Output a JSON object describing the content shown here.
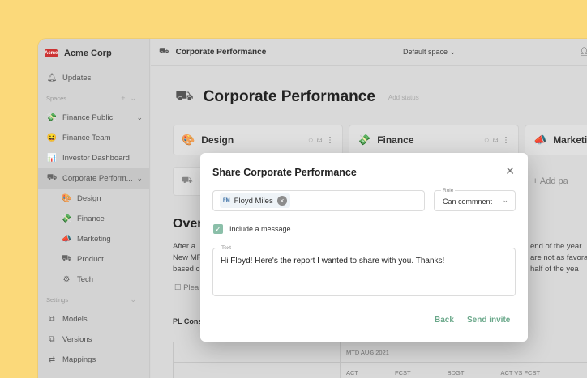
{
  "sidebar": {
    "org_logo": "Acme",
    "org_name": "Acme Corp",
    "updates": "Updates",
    "spaces_label": "Spaces",
    "items": [
      {
        "label": "Finance Public",
        "icon": "💸"
      },
      {
        "label": "Finance Team",
        "icon": "😀"
      },
      {
        "label": "Investor Dashboard",
        "icon": "📊"
      },
      {
        "label": "Corporate Perform...",
        "icon": "⛟"
      }
    ],
    "children": [
      {
        "label": "Design",
        "icon": "🎨"
      },
      {
        "label": "Finance",
        "icon": "💸"
      },
      {
        "label": "Marketing",
        "icon": "📣"
      },
      {
        "label": "Product",
        "icon": "⛟"
      },
      {
        "label": "Tech",
        "icon": "⚙"
      }
    ],
    "settings_label": "Settings",
    "settings_items": [
      {
        "label": "Models",
        "icon": "⧉"
      },
      {
        "label": "Versions",
        "icon": "⧉"
      },
      {
        "label": "Mappings",
        "icon": "⇄"
      }
    ]
  },
  "topbar": {
    "title": "Corporate Performance",
    "space": "Default space"
  },
  "page": {
    "title": "Corporate Performance",
    "status": "Add status"
  },
  "cards": [
    {
      "name": "Design",
      "icon": "🎨"
    },
    {
      "name": "Finance",
      "icon": "💸"
    },
    {
      "name": "Marketi",
      "icon": "📣"
    }
  ],
  "add_page": "+  Add pa",
  "overview": {
    "heading": "Over",
    "lines": [
      "After a",
      "New MF",
      "based c"
    ],
    "right_lines": [
      "end of the year.",
      "are not as favora",
      "half of the yea"
    ],
    "checkbox_text": "Plea"
  },
  "pl": {
    "heading": "PL Cons",
    "mtd": "MTD  AUG 2021",
    "cols": [
      "ACT",
      "FCST",
      "BDGT",
      "ACT VS FCST"
    ]
  },
  "modal": {
    "title": "Share Corporate Performance",
    "invitee_initials": "FM",
    "invitee_name": "Floyd Miles",
    "role_label": "Role",
    "role_value": "Can commnent",
    "include_message": "Include a message",
    "text_label": "Text",
    "message": "Hi Floyd! Here's the report I wanted to share with you. Thanks!",
    "back": "Back",
    "send": "Send invite"
  }
}
